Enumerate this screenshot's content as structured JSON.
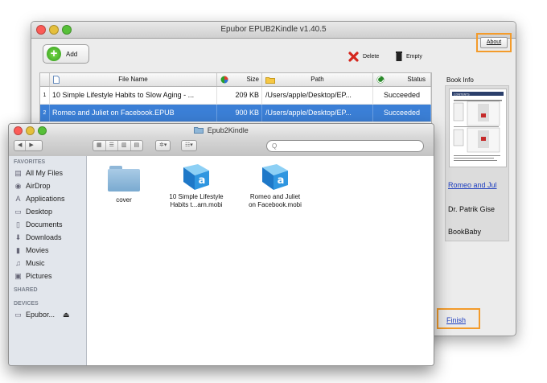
{
  "main_window": {
    "title": "Epubor EPUB2Kindle v1.40.5",
    "toolbar": {
      "add_label": "Add",
      "delete_label": "Delete",
      "empty_label": "Empty",
      "about_label": "About"
    },
    "table": {
      "columns": [
        "File Name",
        "Size",
        "Path",
        "Status"
      ],
      "rows": [
        {
          "num": "1",
          "file": "10 Simple Lifestyle Habits to Slow Aging - ...",
          "size": "209 KB",
          "path": "/Users/apple/Desktop/EP...",
          "status": "Succeeded",
          "selected": false
        },
        {
          "num": "2",
          "file": "Romeo and Juliet on Facebook.EPUB",
          "size": "900 KB",
          "path": "/Users/apple/Desktop/EP...",
          "status": "Succeeded",
          "selected": true
        }
      ]
    },
    "book_info": {
      "label": "Book Info",
      "cover_header": "CONTENTS",
      "title": "Romeo and Jul",
      "author": "Dr. Patrik Gise",
      "publisher": "BookBaby"
    },
    "finish_label": "Finish"
  },
  "finder": {
    "title": "Epub2Kindle",
    "search_placeholder": "Q",
    "sidebar": {
      "favorites_header": "FAVORITES",
      "favorites": [
        {
          "label": "All My Files",
          "icon": "all-files-icon"
        },
        {
          "label": "AirDrop",
          "icon": "airdrop-icon"
        },
        {
          "label": "Applications",
          "icon": "applications-icon"
        },
        {
          "label": "Desktop",
          "icon": "desktop-icon"
        },
        {
          "label": "Documents",
          "icon": "documents-icon"
        },
        {
          "label": "Downloads",
          "icon": "downloads-icon"
        },
        {
          "label": "Movies",
          "icon": "movies-icon"
        },
        {
          "label": "Music",
          "icon": "music-icon"
        },
        {
          "label": "Pictures",
          "icon": "pictures-icon"
        }
      ],
      "shared_header": "SHARED",
      "devices_header": "DEVICES",
      "devices": [
        {
          "label": "Epubor...",
          "icon": "disk-icon"
        }
      ]
    },
    "files": [
      {
        "name_line1": "cover",
        "name_line2": "",
        "kind": "folder"
      },
      {
        "name_line1": "10 Simple Lifestyle",
        "name_line2": "Habits t...arn.mobi",
        "kind": "mobi"
      },
      {
        "name_line1": "Romeo and Juliet",
        "name_line2": "on Facebook.mobi",
        "kind": "mobi"
      }
    ]
  },
  "colors": {
    "highlight_orange": "#f39b2b",
    "selection_blue": "#3b7fd6",
    "link_blue": "#1f3fbf"
  }
}
